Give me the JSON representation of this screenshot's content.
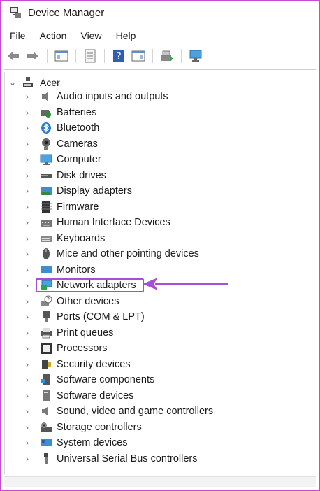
{
  "window": {
    "title": "Device Manager"
  },
  "menu": [
    "File",
    "Action",
    "View",
    "Help"
  ],
  "tree": {
    "root": "Acer",
    "items": [
      {
        "label": "Audio inputs and outputs",
        "icon": "speaker-icon"
      },
      {
        "label": "Batteries",
        "icon": "battery-icon"
      },
      {
        "label": "Bluetooth",
        "icon": "bluetooth-icon"
      },
      {
        "label": "Cameras",
        "icon": "camera-icon"
      },
      {
        "label": "Computer",
        "icon": "computer-icon"
      },
      {
        "label": "Disk drives",
        "icon": "disk-icon"
      },
      {
        "label": "Display adapters",
        "icon": "display-adapter-icon"
      },
      {
        "label": "Firmware",
        "icon": "firmware-icon"
      },
      {
        "label": "Human Interface Devices",
        "icon": "hid-icon"
      },
      {
        "label": "Keyboards",
        "icon": "keyboard-icon"
      },
      {
        "label": "Mice and other pointing devices",
        "icon": "mouse-icon"
      },
      {
        "label": "Monitors",
        "icon": "monitor-icon"
      },
      {
        "label": "Network adapters",
        "icon": "network-icon"
      },
      {
        "label": "Other devices",
        "icon": "unknown-device-icon"
      },
      {
        "label": "Ports (COM & LPT)",
        "icon": "port-icon"
      },
      {
        "label": "Print queues",
        "icon": "printer-icon"
      },
      {
        "label": "Processors",
        "icon": "processor-icon"
      },
      {
        "label": "Security devices",
        "icon": "security-icon"
      },
      {
        "label": "Software components",
        "icon": "software-component-icon"
      },
      {
        "label": "Software devices",
        "icon": "software-device-icon"
      },
      {
        "label": "Sound, video and game controllers",
        "icon": "sound-icon"
      },
      {
        "label": "Storage controllers",
        "icon": "storage-icon"
      },
      {
        "label": "System devices",
        "icon": "system-icon"
      },
      {
        "label": "Universal Serial Bus controllers",
        "icon": "usb-icon"
      }
    ],
    "highlighted": "Network adapters"
  },
  "colors": {
    "highlight": "#a64fd6",
    "frame": "#c64ad0",
    "accent": "#2b7fd4"
  }
}
